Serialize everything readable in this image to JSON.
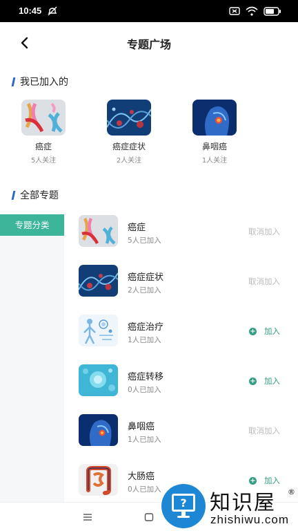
{
  "status_bar": {
    "time": "10:45"
  },
  "header": {
    "title": "专题广场"
  },
  "joined": {
    "section_title": "我已加入的",
    "items": [
      {
        "name": "癌症",
        "count": "5人关注",
        "image": "ribbons"
      },
      {
        "name": "癌症症状",
        "count": "2人关注",
        "image": "dna-cells"
      },
      {
        "name": "鼻咽癌",
        "count": "1人关注",
        "image": "head-scan"
      }
    ]
  },
  "all_topics": {
    "section_title": "全部专题",
    "category": "专题分类",
    "items": [
      {
        "name": "癌症",
        "count": "5人已加入",
        "action": "取消加入",
        "joined": true,
        "image": "ribbons"
      },
      {
        "name": "癌症症状",
        "count": "2人已加入",
        "action": "取消加入",
        "joined": true,
        "image": "dna-cells"
      },
      {
        "name": "癌症治疗",
        "count": "1人已加入",
        "action": "加入",
        "joined": false,
        "image": "medical-figure"
      },
      {
        "name": "癌症转移",
        "count": "0人已加入",
        "action": "加入",
        "joined": false,
        "image": "cyan-cells"
      },
      {
        "name": "鼻咽癌",
        "count": "1人已加入",
        "action": "取消加入",
        "joined": true,
        "image": "head-scan"
      },
      {
        "name": "大肠癌",
        "count": "0人已加入",
        "action": "加入",
        "joined": false,
        "image": "intestine"
      }
    ]
  },
  "watermark": {
    "text": "知识屋",
    "url": "zhishiwu.com",
    "mark": "®"
  },
  "colors": {
    "accent": "#3cb59a",
    "join": "#2f9e83",
    "section_bar": "#2b66c8",
    "cancel": "#bbbbbb"
  }
}
